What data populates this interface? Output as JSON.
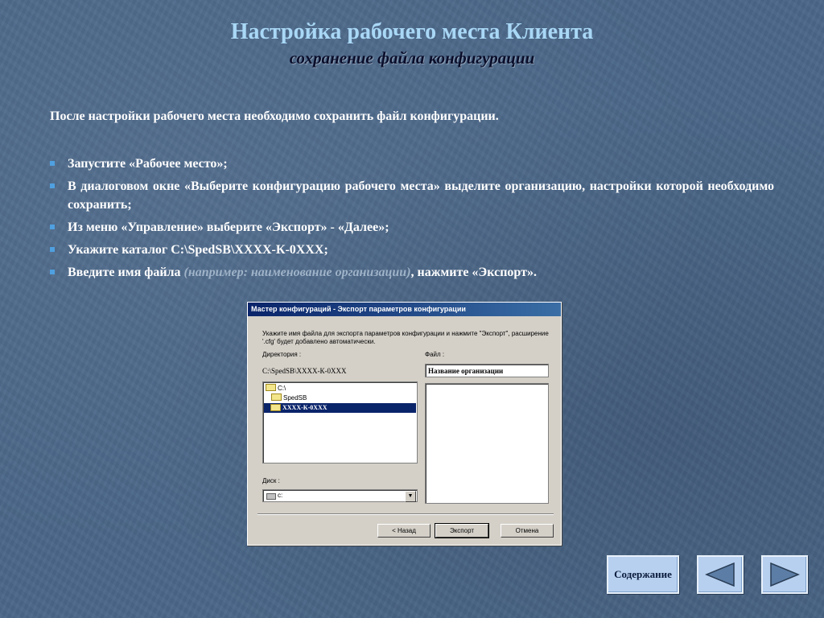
{
  "slide": {
    "title": "Настройка рабочего места Клиента",
    "subtitle": "сохранение файла конфигурации",
    "intro": "После настройки рабочего места необходимо сохранить файл конфигурации.",
    "bullets": [
      "Запустите «Рабочее место»;",
      "В диалоговом окне «Выберите конфигурацию рабочего места» выделите организацию, настройки которой необходимо сохранить;",
      "Из меню «Управление» выберите «Экспорт» - «Далее»;",
      "Укажите каталог C:\\SpedSB\\XXXX-К-0XXX;",
      {
        "text_before": "Введите имя файла",
        "example": "(например: наименование организации)",
        "text_after": ", нажмите «Экспорт»."
      }
    ],
    "accent_color": "#a9d8f6",
    "bullet_color": "#4fa0e0"
  },
  "dialog": {
    "title": "Мастер конфигураций - Экспорт параметров конфигурации",
    "instruction": "Укажите имя файла для экспорта параметров конфигурации и нажмите \"Экспорт\", расширение '.cfg' будет добавлено автоматически.",
    "directory_label": "Директория :",
    "file_label": "Файл :",
    "current_path": "C:\\SpedSB\\XXXX-К-0XXX",
    "file_name_value": "Название организации",
    "tree": [
      {
        "label": "C:\\",
        "selected": false
      },
      {
        "label": "SpedSB",
        "selected": false
      },
      {
        "label": "XXXX-К-0XXX",
        "selected": true
      }
    ],
    "disk_label": "Диск :",
    "disk_value": "c:",
    "buttons": {
      "back": "< Назад",
      "export": "Экспорт",
      "cancel": "Отмена"
    }
  },
  "nav": {
    "contents_label": "Содержание",
    "prev_icon": "triangle-left-icon",
    "next_icon": "triangle-right-icon"
  }
}
